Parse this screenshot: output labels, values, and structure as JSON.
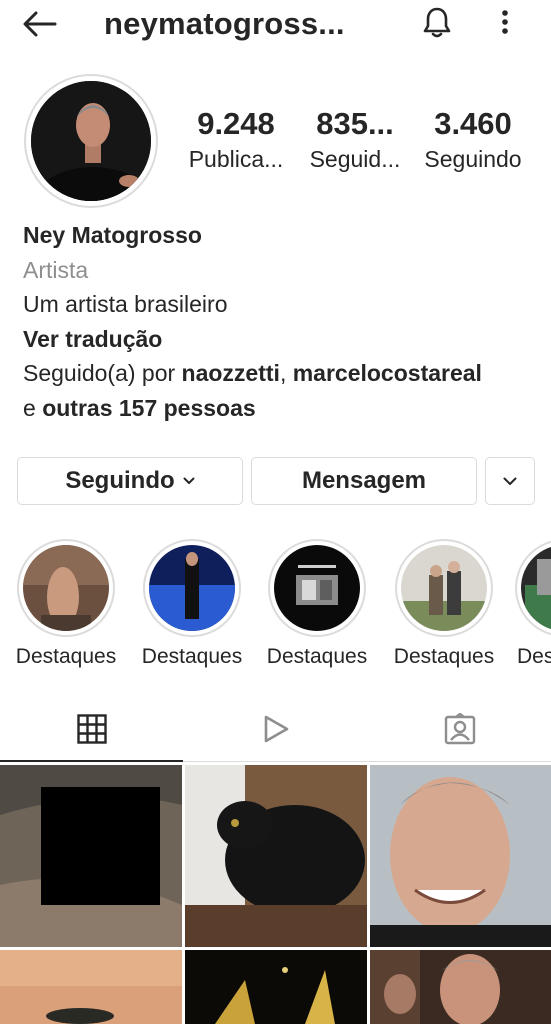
{
  "header": {
    "username": "neymatogross...",
    "icons": {
      "back": "arrow-left-icon",
      "bell": "bell-icon",
      "more": "more-vertical-icon"
    }
  },
  "profile": {
    "stats": [
      {
        "value": "9.248",
        "label": "Publica..."
      },
      {
        "value": "835...",
        "label": "Seguid..."
      },
      {
        "value": "3.460",
        "label": "Seguindo"
      }
    ],
    "name": "Ney Matogrosso",
    "category": "Artista",
    "bio": "Um artista brasileiro",
    "translate": "Ver tradução",
    "followed_by": {
      "prefix": "Seguido(a) por",
      "user1": "naozzetti",
      "separator": ",",
      "user2": "marcelocostareal",
      "and": "e",
      "others": "outras 157 pessoas"
    }
  },
  "actions": {
    "following_label": "Seguindo",
    "message_label": "Mensagem"
  },
  "highlights": [
    {
      "label": "Destaques"
    },
    {
      "label": "Destaques"
    },
    {
      "label": "Destaques"
    },
    {
      "label": "Destaques"
    },
    {
      "label": "Des"
    }
  ],
  "tabs": [
    {
      "name": "grid",
      "icon": "grid-icon",
      "active": true
    },
    {
      "name": "reels",
      "icon": "play-icon",
      "active": false
    },
    {
      "name": "tagged",
      "icon": "tagged-person-icon",
      "active": false
    }
  ],
  "colors": {
    "text": "#262626",
    "muted": "#8e8e8e",
    "border": "#dbdbdb"
  }
}
